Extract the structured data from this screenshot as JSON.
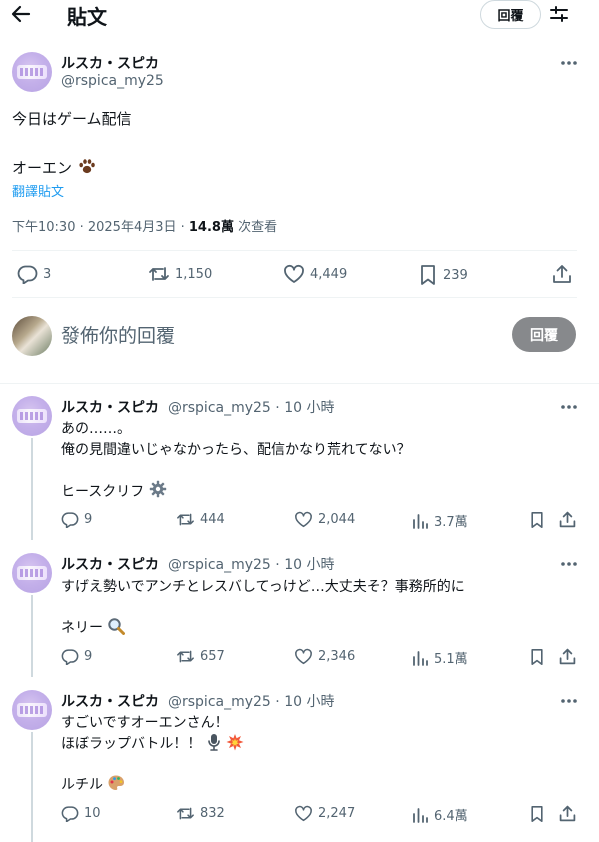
{
  "header": {
    "title": "貼文",
    "reply_label": "回覆"
  },
  "post": {
    "author_name": "ルスカ・スピカ",
    "author_handle": "@rspica_my25",
    "line1": "今日はゲーム配信",
    "line2": "オーエン",
    "translate_label": "翻譯貼文",
    "timestamp": "下午10:30 · 2025年4月3日 · ",
    "views_count": "14.8萬",
    "views_label": " 次查看",
    "replies": "3",
    "reposts": "1,150",
    "likes": "4,449",
    "bookmarks": "239"
  },
  "compose": {
    "placeholder": "發佈你的回覆",
    "button": "回覆"
  },
  "replies": [
    {
      "name": "ルスカ・スピカ",
      "meta": "@rspica_my25 · 10 小時",
      "lines": [
        "あの……。",
        "俺の見間違いじゃなかったら、配信かなり荒れてない？"
      ],
      "sign": "ヒースクリフ",
      "stats": {
        "replies": "9",
        "reposts": "444",
        "likes": "2,044",
        "views": "3.7萬"
      }
    },
    {
      "name": "ルスカ・スピカ",
      "meta": "@rspica_my25 · 10 小時",
      "lines": [
        "すげえ勢いでアンチとレスバしてっけど…大丈夫そ？事務所的に"
      ],
      "sign": "ネリー",
      "stats": {
        "replies": "9",
        "reposts": "657",
        "likes": "2,346",
        "views": "5.1萬"
      }
    },
    {
      "name": "ルスカ・スピカ",
      "meta": "@rspica_my25 · 10 小時",
      "lines": [
        "すごいですオーエンさん！",
        "ほぼラップバトル！！"
      ],
      "sign": "ルチル",
      "stats": {
        "replies": "10",
        "reposts": "832",
        "likes": "2,247",
        "views": "6.4萬"
      }
    }
  ],
  "icons": {
    "back": "arrow-left-icon",
    "tune": "sliders-icon",
    "more": "ellipsis-icon",
    "reply": "comment-icon",
    "repost": "retweet-icon",
    "like": "heart-icon",
    "views": "analytics-icon",
    "bookmark": "bookmark-icon",
    "share": "share-icon",
    "paw": "paw-emoji",
    "gear": "gear-emoji",
    "magnifier": "magnifier-emoji",
    "mic": "microphone-emoji",
    "boom": "collision-emoji",
    "palette": "palette-emoji"
  },
  "colors": {
    "link": "#1d9bf0",
    "muted": "#536471",
    "text": "#0f1419",
    "reply_button": "#87898c"
  }
}
